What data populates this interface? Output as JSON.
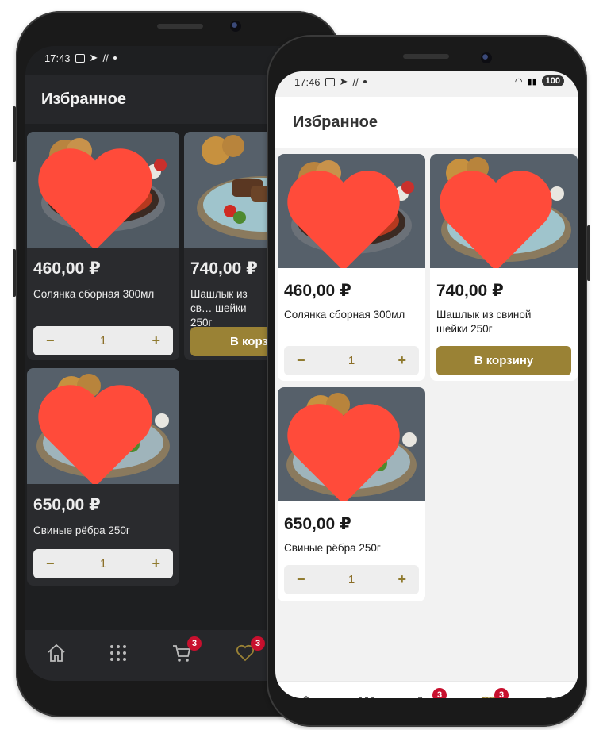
{
  "screens": {
    "dark": {
      "status_time": "17:43",
      "title": "Избранное",
      "products": [
        {
          "price": "460,00 ₽",
          "name": "Солянка сборная 300мл",
          "qty": "1",
          "minus": "−",
          "plus": "+"
        },
        {
          "price": "740,00 ₽",
          "name": "Шашлык из св… шейки 250г",
          "cart_label": "В корзи"
        },
        {
          "price": "650,00 ₽",
          "name": "Свиные рёбра 250г",
          "qty": "1",
          "minus": "−",
          "plus": "+"
        }
      ],
      "nav": {
        "cart_badge": "3",
        "fav_badge": "3"
      }
    },
    "light": {
      "status_time": "17:46",
      "battery": "100",
      "title": "Избранное",
      "products": [
        {
          "price": "460,00 ₽",
          "name": "Солянка сборная 300мл",
          "qty": "1",
          "minus": "−",
          "plus": "+"
        },
        {
          "price": "740,00 ₽",
          "name": "Шашлык из свиной шейки 250г",
          "cart_label": "В корзину"
        },
        {
          "price": "650,00 ₽",
          "name": "Свиные рёбра 250г",
          "qty": "1",
          "minus": "−",
          "plus": "+"
        }
      ],
      "nav": {
        "cart_badge": "3",
        "fav_badge": "3"
      }
    }
  },
  "colors": {
    "accent": "#9a8235",
    "heart": "#ff4b3a",
    "badge": "#c8102e"
  },
  "icons": [
    "home-icon",
    "catalog-grid-icon",
    "cart-icon",
    "heart-icon",
    "profile-icon"
  ]
}
